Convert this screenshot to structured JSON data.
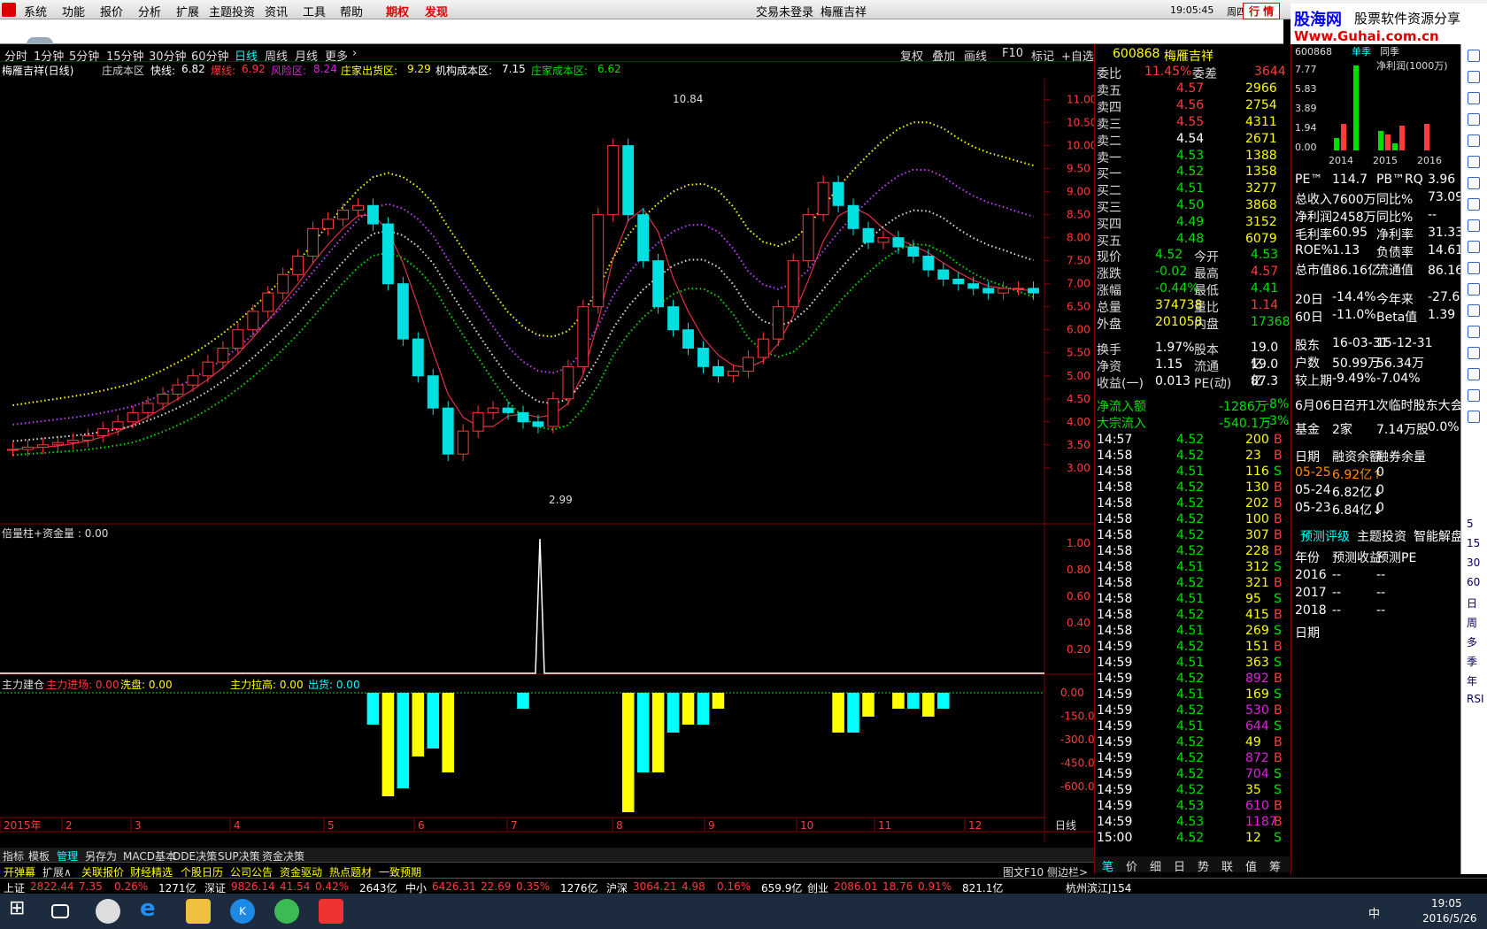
{
  "menu": {
    "items": [
      "系统",
      "功能",
      "报价",
      "分析",
      "扩展",
      "主题投资",
      "资讯",
      "工具",
      "帮助"
    ],
    "special": [
      "期权",
      "发现"
    ],
    "login": "交易未登录",
    "stock_title": "梅雁吉祥",
    "clock": "19:05:45",
    "weekday": "周四",
    "hangqing": "行 情"
  },
  "watermark": {
    "line1": "股海网",
    "line2": "股票软件资源分享",
    "url": "Www.Guhai.com.cn"
  },
  "periods": [
    "分时",
    "1分钟",
    "5分钟",
    "15分钟",
    "30分钟",
    "60分钟",
    "日线",
    "周线",
    "月线",
    "更多"
  ],
  "period_active": "日线",
  "toolbar_right": [
    "复权",
    "叠加",
    "画线",
    "F10",
    "标记",
    "+自选"
  ],
  "info": {
    "name": "梅雁吉祥(日线)",
    "zone": "庄成本区",
    "fast_label": "快线:",
    "fast": "6.82",
    "burst_label": "爆线:",
    "burst": "6.92",
    "risk_label": "风险区:",
    "risk": "8.24",
    "ship_label": "庄家出货区:",
    "ship": "9.29",
    "inst_label": "机构成本区:",
    "inst": "7.15",
    "cost_label": "庄家成本区:",
    "cost": "6.62"
  },
  "price_axis": [
    "11.00",
    "10.50",
    "10.00",
    "9.50",
    "9.00",
    "8.50",
    "8.00",
    "7.50",
    "7.00",
    "6.50",
    "6.00",
    "5.50",
    "5.00",
    "4.50",
    "4.00",
    "3.50",
    "3.00"
  ],
  "price_high": "10.84",
  "price_low": "2.99",
  "vol_panel": {
    "title": "倍量柱+资金量 : 0.00",
    "axis": [
      "1.00",
      "0.80",
      "0.60",
      "0.40",
      "0.20"
    ]
  },
  "main_panel": {
    "t1": "主力建仓",
    "t2": "主力进场: 0.00",
    "t3": "洗盘: 0.00",
    "t4": "主力拉高: 0.00",
    "t5": "出货: 0.00",
    "axis": [
      "0.00",
      "-150.0",
      "-300.0",
      "-450.0",
      "-600.0"
    ]
  },
  "time_axis": [
    "2015年",
    "2",
    "3",
    "4",
    "5",
    "6",
    "7",
    "8",
    "9",
    "10",
    "11",
    "12",
    "日线"
  ],
  "bottom_tabs": [
    "指标",
    "模板",
    "管理",
    "另存为",
    "MACD基本",
    "DDE决策",
    "SUP决策",
    "资金决策"
  ],
  "bottom_tabs2": [
    "开弹幕",
    "扩展∧",
    "关联报价",
    "财经精选",
    "个股日历",
    "公司公告",
    "资金驱动",
    "热点题材",
    "一致预期"
  ],
  "bottom_right": [
    "图文F10",
    "侧边栏>"
  ],
  "quote": {
    "code": "600868",
    "name": "梅雁吉祥",
    "weibi_l": "委比",
    "weibi": "11.45%",
    "weicha_l": "委差",
    "weicha": "3644",
    "asks": [
      {
        "l": "卖五",
        "p": "4.57",
        "v": "2966"
      },
      {
        "l": "卖四",
        "p": "4.56",
        "v": "2754"
      },
      {
        "l": "卖三",
        "p": "4.55",
        "v": "4311"
      },
      {
        "l": "卖二",
        "p": "4.54",
        "v": "2671"
      },
      {
        "l": "卖一",
        "p": "4.53",
        "v": "1388"
      }
    ],
    "bids": [
      {
        "l": "买一",
        "p": "4.52",
        "v": "1358"
      },
      {
        "l": "买二",
        "p": "4.51",
        "v": "3277"
      },
      {
        "l": "买三",
        "p": "4.50",
        "v": "3868"
      },
      {
        "l": "买四",
        "p": "4.49",
        "v": "3152"
      },
      {
        "l": "买五",
        "p": "4.48",
        "v": "6079"
      }
    ],
    "stats": [
      [
        "现价",
        "4.52",
        "今开",
        "4.53"
      ],
      [
        "涨跌",
        "-0.02",
        "最高",
        "4.57"
      ],
      [
        "涨幅",
        "-0.44%",
        "最低",
        "4.41"
      ],
      [
        "总量",
        "374738",
        "量比",
        "1.14"
      ],
      [
        "外盘",
        "201058",
        "内盘",
        "173680"
      ]
    ],
    "stats2": [
      [
        "换手",
        "1.97%",
        "股本",
        "19.0亿"
      ],
      [
        "净资",
        "1.15",
        "流通",
        "19.0亿"
      ],
      [
        "收益(一)",
        "0.013",
        "PE(动)",
        "87.3"
      ]
    ],
    "flow": [
      [
        "净流入额",
        "-1286万",
        "-8%"
      ],
      [
        "大宗流入",
        "-540.1万",
        "-3%"
      ]
    ],
    "ticks": [
      [
        "14:57",
        "4.52",
        "200",
        "B"
      ],
      [
        "14:58",
        "4.52",
        "23",
        "B"
      ],
      [
        "14:58",
        "4.51",
        "116",
        "S"
      ],
      [
        "14:58",
        "4.52",
        "130",
        "B"
      ],
      [
        "14:58",
        "4.52",
        "202",
        "B"
      ],
      [
        "14:58",
        "4.52",
        "100",
        "B"
      ],
      [
        "14:58",
        "4.52",
        "307",
        "B"
      ],
      [
        "14:58",
        "4.52",
        "228",
        "B"
      ],
      [
        "14:58",
        "4.51",
        "312",
        "S"
      ],
      [
        "14:58",
        "4.52",
        "321",
        "B"
      ],
      [
        "14:58",
        "4.51",
        "95",
        "S"
      ],
      [
        "14:58",
        "4.52",
        "415",
        "B"
      ],
      [
        "14:58",
        "4.51",
        "269",
        "S"
      ],
      [
        "14:59",
        "4.52",
        "151",
        "B"
      ],
      [
        "14:59",
        "4.51",
        "363",
        "S"
      ],
      [
        "14:59",
        "4.52",
        "892",
        "B"
      ],
      [
        "14:59",
        "4.51",
        "169",
        "S"
      ],
      [
        "14:59",
        "4.52",
        "530",
        "B"
      ],
      [
        "14:59",
        "4.51",
        "644",
        "S"
      ],
      [
        "14:59",
        "4.52",
        "49",
        "B"
      ],
      [
        "14:59",
        "4.52",
        "872",
        "B"
      ],
      [
        "14:59",
        "4.52",
        "704",
        "S"
      ],
      [
        "14:59",
        "4.52",
        "35",
        "S"
      ],
      [
        "14:59",
        "4.53",
        "610",
        "B"
      ],
      [
        "14:59",
        "4.53",
        "1187",
        "B"
      ],
      [
        "15:00",
        "4.52",
        "12",
        "S"
      ]
    ],
    "tabs": [
      "笔",
      "价",
      "细",
      "日",
      "势",
      "联",
      "值",
      "筹"
    ]
  },
  "fund": {
    "head": "600868",
    "season": "单季",
    "yoy": "同季",
    "profit_label": "净利润(1000万)",
    "yaxis": [
      "7.77",
      "5.83",
      "3.89",
      "1.94",
      "0.00"
    ],
    "years": [
      "2014",
      "2015",
      "2016"
    ],
    "rows": [
      [
        "PE™",
        "114.7",
        "PB™RQ",
        "3.96"
      ],
      [
        "总收入",
        "7600万",
        "同比%",
        "73.09"
      ],
      [
        "净利润",
        "2458万",
        "同比%",
        "--"
      ],
      [
        "毛利率",
        "60.95",
        "净利率",
        "31.33"
      ],
      [
        "ROE%",
        "1.13",
        "负债率",
        "14.61"
      ],
      [
        "总市值",
        "86.16亿",
        "流通值",
        "86.16亿"
      ]
    ],
    "perf": [
      [
        "20日",
        "-14.4%",
        "今年来",
        "-27.6%"
      ],
      [
        "60日",
        "-11.0%",
        "Beta值",
        "1.39"
      ]
    ],
    "holders": {
      "h": [
        "股东",
        "16-03-31",
        "15-12-31"
      ],
      "r1": [
        "户数",
        "50.99万",
        "56.34万"
      ],
      "r2": [
        "较上期",
        "-9.49%",
        "-7.04%"
      ]
    },
    "notice": "6月06日召开1次临时股东大会",
    "fundrow": [
      "基金",
      "2家",
      "7.14万股",
      "0.0%"
    ],
    "margin_head": [
      "日期",
      "融资余额",
      "融券余量"
    ],
    "margin": [
      [
        "05-25",
        "6.92亿↑",
        "0"
      ],
      [
        "05-24",
        "6.82亿↓",
        "0"
      ],
      [
        "05-23",
        "6.84亿↓",
        "0"
      ]
    ],
    "tabs": [
      "预测评级",
      "主题投资",
      "智能解盘"
    ],
    "fc_head": [
      "年份",
      "预测收益",
      "预测PE"
    ],
    "fc": [
      [
        "2016",
        "--",
        "--"
      ],
      [
        "2017",
        "--",
        "--"
      ],
      [
        "2018",
        "--",
        "--"
      ]
    ],
    "date_label": "日期"
  },
  "side": [
    "5",
    "15",
    "30",
    "60",
    "日",
    "周",
    "多",
    "季",
    "年",
    "RSI"
  ],
  "ticker": [
    {
      "n": "上证",
      "v": "2822.44",
      "c": "7.35",
      "p": "0.26%",
      "a": "1271亿"
    },
    {
      "n": "深证",
      "v": "9826.14",
      "c": "41.54",
      "p": "0.42%",
      "a": "2643亿"
    },
    {
      "n": "中小",
      "v": "6426.31",
      "c": "22.69",
      "p": "0.35%",
      "a": "1276亿"
    },
    {
      "n": "沪深",
      "v": "3064.21",
      "c": "4.98",
      "p": "0.16%",
      "a": "659.9亿"
    },
    {
      "n": "创业",
      "v": "2086.01",
      "c": "18.76",
      "p": "0.91%",
      "a": "821.1亿"
    }
  ],
  "ticker_city": "杭州滨江J154",
  "taskbar": {
    "time": "19:05",
    "date": "2016/5/26",
    "lang": "中"
  },
  "colors": {
    "up": "#ff3b3b",
    "down": "#00e0e0",
    "yellow": "#ffff00",
    "green": "#00e000",
    "ma": "#e0304a"
  },
  "chart_data": {
    "type": "line",
    "title": "梅雁吉祥(日线)",
    "ylim": [
      2.9,
      11.3
    ],
    "hi": 10.84,
    "lo": 2.99,
    "months": [
      "2015年",
      "2",
      "3",
      "4",
      "5",
      "6",
      "7",
      "8",
      "9",
      "10",
      "11",
      "12"
    ],
    "close": [
      3.4,
      3.45,
      3.5,
      3.55,
      3.6,
      3.7,
      3.85,
      4.0,
      4.2,
      4.4,
      4.6,
      4.8,
      5.0,
      5.3,
      5.6,
      6.0,
      6.4,
      6.8,
      7.2,
      7.6,
      8.2,
      8.4,
      8.6,
      8.7,
      8.3,
      7.0,
      5.8,
      5.0,
      4.3,
      3.3,
      3.8,
      4.2,
      4.3,
      4.2,
      4.0,
      3.9,
      4.5,
      5.2,
      6.5,
      8.5,
      10.0,
      8.5,
      7.5,
      6.5,
      6.0,
      5.6,
      5.2,
      5.0,
      5.1,
      5.4,
      5.8,
      6.5,
      7.5,
      8.5,
      9.2,
      8.7,
      8.2,
      7.9,
      8.0,
      7.8,
      7.6,
      7.3,
      7.1,
      7.0,
      6.9,
      6.8,
      6.9,
      6.9,
      6.8
    ]
  }
}
